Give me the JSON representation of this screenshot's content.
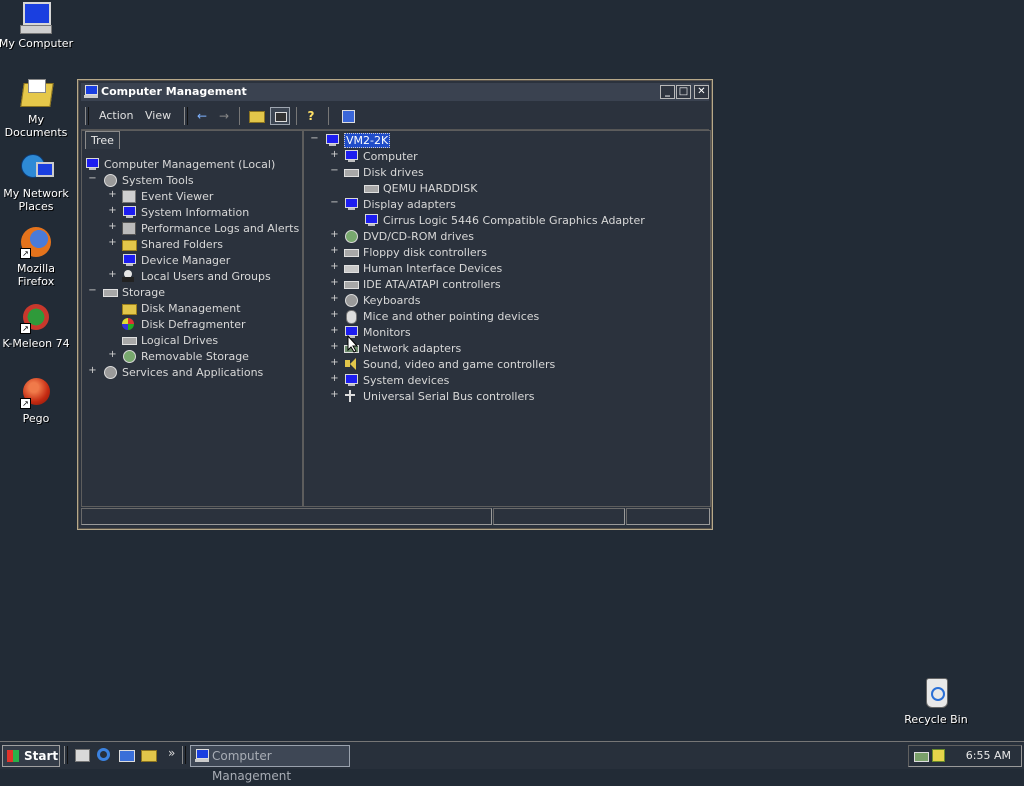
{
  "desktop": {
    "icons": [
      {
        "label": "My Computer"
      },
      {
        "label": "My Documents"
      },
      {
        "label": "My Network Places"
      },
      {
        "label": "Mozilla Firefox"
      },
      {
        "label": "K-Meleon 74"
      },
      {
        "label": "Pego"
      },
      {
        "label": "Recycle Bin"
      }
    ]
  },
  "window": {
    "title": "Computer Management",
    "menu": {
      "action": "Action",
      "view": "View"
    },
    "toolbar_icons": [
      "back-arrow-icon",
      "forward-arrow-icon",
      "up-folder-icon",
      "show-hide-tree-icon",
      "help-icon",
      "properties-icon"
    ],
    "tree_tab": "Tree",
    "tree": [
      {
        "label": "Computer Management (Local)",
        "expander": ""
      },
      {
        "label": "System Tools",
        "expander": "−"
      },
      {
        "label": "Event Viewer",
        "expander": "+"
      },
      {
        "label": "System Information",
        "expander": "+"
      },
      {
        "label": "Performance Logs and Alerts",
        "expander": "+"
      },
      {
        "label": "Shared Folders",
        "expander": "+"
      },
      {
        "label": "Device Manager",
        "expander": ""
      },
      {
        "label": "Local Users and Groups",
        "expander": "+"
      },
      {
        "label": "Storage",
        "expander": "−"
      },
      {
        "label": "Disk Management",
        "expander": ""
      },
      {
        "label": "Disk Defragmenter",
        "expander": ""
      },
      {
        "label": "Logical Drives",
        "expander": ""
      },
      {
        "label": "Removable Storage",
        "expander": "+"
      },
      {
        "label": "Services and Applications",
        "expander": "+"
      }
    ],
    "devices": [
      {
        "label": "VM2-2K",
        "expander": "−"
      },
      {
        "label": "Computer",
        "expander": "+"
      },
      {
        "label": "Disk drives",
        "expander": "−"
      },
      {
        "label": "QEMU HARDDISK",
        "expander": ""
      },
      {
        "label": "Display adapters",
        "expander": "−"
      },
      {
        "label": "Cirrus Logic 5446 Compatible Graphics Adapter",
        "expander": ""
      },
      {
        "label": "DVD/CD-ROM drives",
        "expander": "+"
      },
      {
        "label": "Floppy disk controllers",
        "expander": "+"
      },
      {
        "label": "Human Interface Devices",
        "expander": "+"
      },
      {
        "label": "IDE ATA/ATAPI controllers",
        "expander": "+"
      },
      {
        "label": "Keyboards",
        "expander": "+"
      },
      {
        "label": "Mice and other pointing devices",
        "expander": "+"
      },
      {
        "label": "Monitors",
        "expander": "+"
      },
      {
        "label": "Network adapters",
        "expander": "+"
      },
      {
        "label": "Sound, video and game controllers",
        "expander": "+"
      },
      {
        "label": "System devices",
        "expander": "+"
      },
      {
        "label": "Universal Serial Bus controllers",
        "expander": "+"
      }
    ]
  },
  "taskbar": {
    "start_label": "Start",
    "quick_launch_more": "»",
    "task_button": "Computer Management",
    "clock": "6:55 AM"
  },
  "colors": {
    "desktop_bg": "#222b36",
    "selection": "#1f4cc8"
  }
}
